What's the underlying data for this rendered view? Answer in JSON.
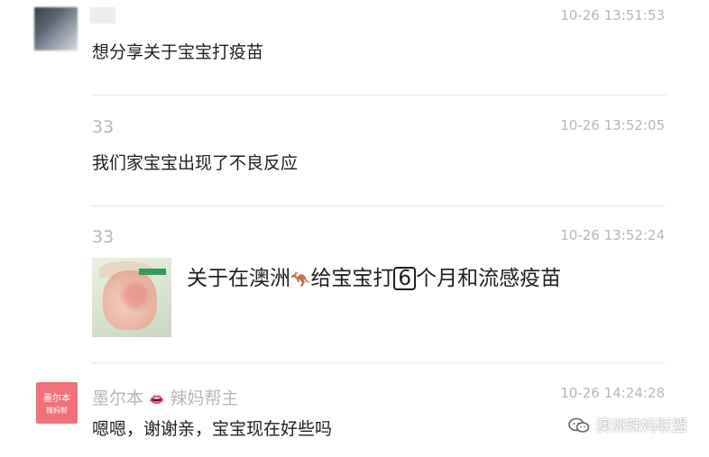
{
  "messages": [
    {
      "name": "",
      "time": "10-26 13:51:53",
      "text": "想分享关于宝宝打疫苗"
    },
    {
      "name": "33",
      "time": "10-26 13:52:05",
      "text": "我们家宝宝出现了不良反应"
    },
    {
      "name": "33",
      "time": "10-26 13:52:24",
      "card": {
        "title_part1": "关于在澳洲",
        "title_part2": "给宝宝打",
        "number": "6",
        "title_part3": "个月和流感疫苗"
      }
    },
    {
      "name_part1": "墨尔本",
      "name_part2": "辣妈帮主",
      "time": "10-26 14:24:28",
      "text": "嗯嗯，谢谢亲，宝宝现在好些吗",
      "avatar_line1": "墨尔本",
      "avatar_line2": "辣妈帮"
    }
  ],
  "watermark": "澳洲辣妈联盟",
  "icons": {
    "kangaroo": "kangaroo-icon",
    "lips": "lips-icon",
    "wechat": "wechat-icon"
  },
  "colors": {
    "meta": "#b7b7b7",
    "text": "#1f1f1f",
    "divider": "#e6e6e6",
    "brand": "#f2707a"
  }
}
